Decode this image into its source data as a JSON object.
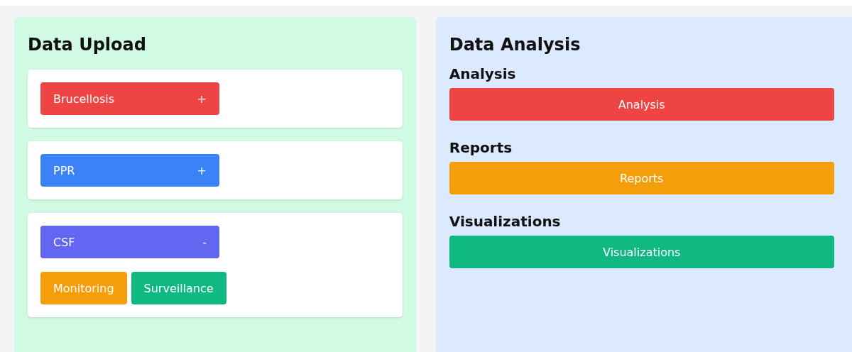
{
  "upload": {
    "title": "Data Upload",
    "diseases": [
      {
        "label": "Brucellosis",
        "symbol": "+",
        "color": "#ef4444"
      },
      {
        "label": "PPR",
        "symbol": "+",
        "color": "#3b82f6"
      },
      {
        "label": "CSF",
        "symbol": "-",
        "color": "#6366f1",
        "options": [
          {
            "label": "Monitoring",
            "color": "#f59e0b"
          },
          {
            "label": "Surveillance",
            "color": "#10b981"
          }
        ]
      }
    ]
  },
  "analysis": {
    "title": "Data Analysis",
    "sections": [
      {
        "heading": "Analysis",
        "button": "Analysis",
        "color": "#ef4444"
      },
      {
        "heading": "Reports",
        "button": "Reports",
        "color": "#f59e0b"
      },
      {
        "heading": "Visualizations",
        "button": "Visualizations",
        "color": "#10b981"
      }
    ]
  }
}
